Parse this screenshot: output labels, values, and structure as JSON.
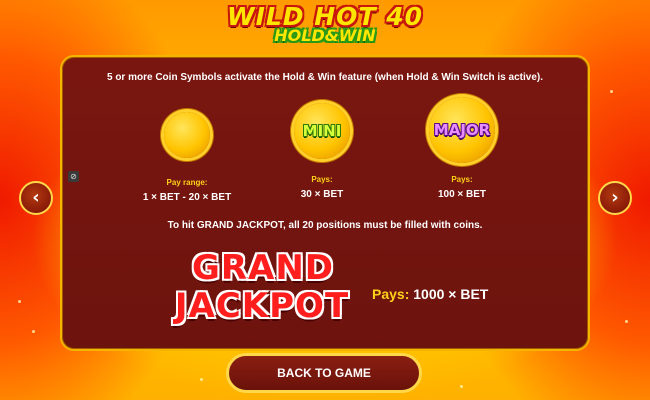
{
  "logo": {
    "line1": "WILD HOT 40",
    "line2": "HOLD&WIN"
  },
  "intro": "5 or more Coin Symbols activate the Hold & Win feature (when Hold & Win Switch is active).",
  "symbols": [
    {
      "coin_label": "",
      "pay_label": "Pay range:",
      "pay_value": "1 × BET - 20 × BET"
    },
    {
      "coin_label": "MINI",
      "pay_label": "Pays:",
      "pay_value": "30 × BET"
    },
    {
      "coin_label": "MAJOR",
      "pay_label": "Pays:",
      "pay_value": "100 × BET"
    }
  ],
  "grand": {
    "condition": "To hit GRAND JACKPOT, all 20 positions must be filled with coins.",
    "word1": "GRAND",
    "word2": "JACKPOT",
    "pays_label": "Pays:",
    "pays_value": "1000 × BET"
  },
  "nav": {
    "prev_icon": "‹",
    "next_icon": "›"
  },
  "back_button": "BACK TO GAME",
  "icons": {
    "small": "⊘"
  },
  "colors": {
    "panel": "#7a1610",
    "border": "#f5b400",
    "label_yellow": "#ffd21a",
    "grand_red": "#ff1e1e",
    "mini_green": "#d7ff3a",
    "major_purple": "#e88cff"
  }
}
